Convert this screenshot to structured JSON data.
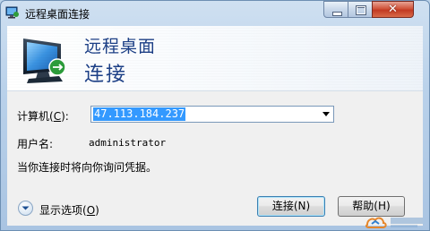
{
  "window": {
    "title": "远程桌面连接"
  },
  "banner": {
    "line1": "远程桌面",
    "line2": "连接"
  },
  "form": {
    "computer_label": "计算机(",
    "computer_label_key": "C",
    "computer_label_end": "):",
    "computer_value": "47.113.184.237",
    "username_label": "用户名:",
    "username_value": "administrator",
    "info_text": "当你连接时将向你询问凭据。"
  },
  "footer": {
    "options_label": "显示选项(",
    "options_key": "O",
    "options_end": ")",
    "connect_label": "连接(N)",
    "help_label": "帮助(H)"
  },
  "icons": {
    "app": "remote-desktop-icon",
    "options": "chevron-down-circle-icon"
  }
}
